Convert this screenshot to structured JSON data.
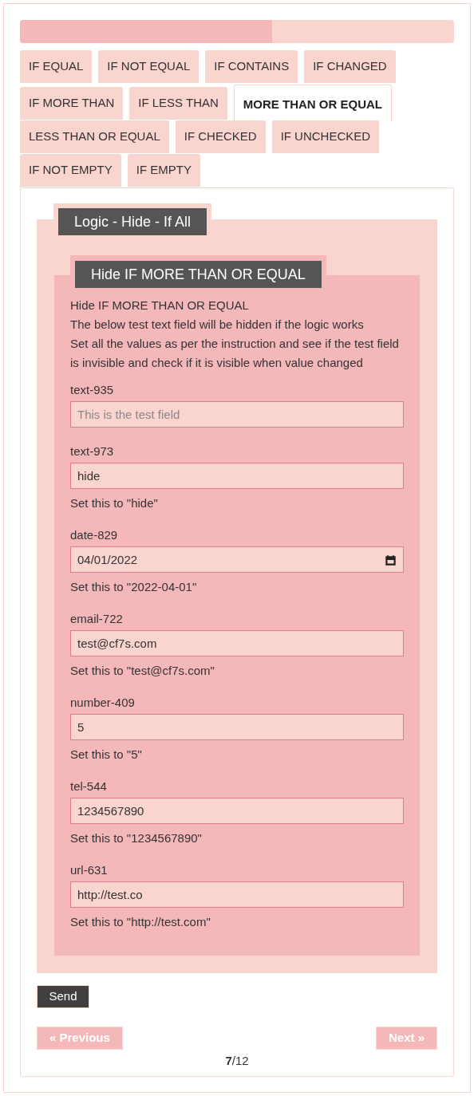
{
  "progress": {
    "level": 0.58
  },
  "tabs": [
    {
      "label": "IF EQUAL",
      "selected": false
    },
    {
      "label": "IF NOT EQUAL",
      "selected": false
    },
    {
      "label": "IF CONTAINS",
      "selected": false
    },
    {
      "label": "IF CHANGED",
      "selected": false
    },
    {
      "label": "IF MORE THAN",
      "selected": false
    },
    {
      "label": "IF LESS THAN",
      "selected": false
    },
    {
      "label": "MORE THAN OR EQUAL",
      "selected": true
    },
    {
      "label": "LESS THAN OR EQUAL",
      "selected": false
    },
    {
      "label": "IF CHECKED",
      "selected": false
    },
    {
      "label": "IF UNCHECKED",
      "selected": false
    },
    {
      "label": "IF NOT EMPTY",
      "selected": false
    },
    {
      "label": "IF EMPTY",
      "selected": false
    }
  ],
  "outer_group": {
    "legend": "Logic - Hide - If All",
    "inner_group": {
      "legend": "Hide IF MORE THAN OR EQUAL",
      "description": [
        "Hide IF MORE THAN OR EQUAL",
        "The below test text field will be hidden if the logic works",
        "Set all the values as per the instruction and see if the test field is invisible and check if it is visible when value changed"
      ],
      "fields": [
        {
          "kind": "text",
          "label": "text-935",
          "placeholder": "This is the test field"
        },
        {
          "kind": "text",
          "label": "text-973",
          "value": "hide",
          "hint": "Set this to \"hide\""
        },
        {
          "kind": "date",
          "label": "date-829",
          "value": "04/01/2022",
          "hint": "Set this to \"2022-04-01\""
        },
        {
          "kind": "text",
          "label": "email-722",
          "value": "test@cf7s.com",
          "hint": "Set this to \"test@cf7s.com\""
        },
        {
          "kind": "text",
          "label": "number-409",
          "value": "5",
          "hint": "Set this to \"5\""
        },
        {
          "kind": "text",
          "label": "tel-544",
          "value": "1234567890",
          "hint": "Set this to \"1234567890\""
        },
        {
          "kind": "text",
          "label": "url-631",
          "value": "http://test.co",
          "hint": "Set this to \"http://test.com\""
        }
      ]
    }
  },
  "send_button": "Send",
  "previous_button": "« Previous",
  "next_button": "Next »",
  "page_indicator": "**7**/12"
}
